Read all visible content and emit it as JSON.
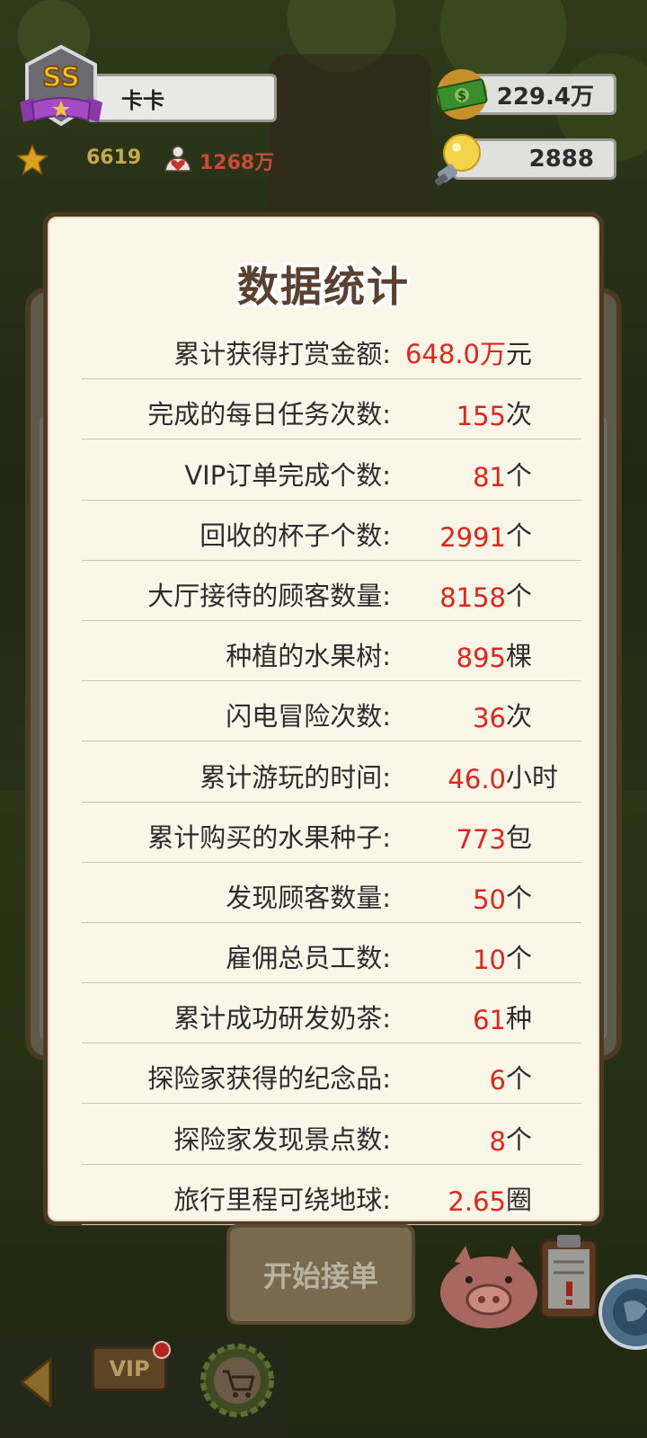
{
  "player": {
    "rank": "SS",
    "name": "卡卡",
    "stars": "6619",
    "fans": "1268万"
  },
  "currency": {
    "money": "229.4万",
    "ideas": "2888"
  },
  "modal": {
    "title": "数据统计",
    "stats": [
      {
        "label": "累计获得打赏金额:",
        "value": "648.0万",
        "unit": "元"
      },
      {
        "label": "完成的每日任务次数:",
        "value": "155",
        "unit": "次"
      },
      {
        "label": "VIP订单完成个数:",
        "value": "81",
        "unit": "个"
      },
      {
        "label": "回收的杯子个数:",
        "value": "2991",
        "unit": "个"
      },
      {
        "label": "大厅接待的顾客数量:",
        "value": "8158",
        "unit": "个"
      },
      {
        "label": "种植的水果树:",
        "value": "895",
        "unit": "棵"
      },
      {
        "label": "闪电冒险次数:",
        "value": "36",
        "unit": "次"
      },
      {
        "label": "累计游玩的时间:",
        "value": "46.0",
        "unit": "小时"
      },
      {
        "label": "累计购买的水果种子:",
        "value": "773",
        "unit": "包"
      },
      {
        "label": "发现顾客数量:",
        "value": "50",
        "unit": "个"
      },
      {
        "label": "雇佣总员工数:",
        "value": "10",
        "unit": "个"
      },
      {
        "label": "累计成功研发奶茶:",
        "value": "61",
        "unit": "种"
      },
      {
        "label": "探险家获得的纪念品:",
        "value": "6",
        "unit": "个"
      },
      {
        "label": "探险家发现景点数:",
        "value": "8",
        "unit": "个"
      },
      {
        "label": "旅行里程可绕地球:",
        "value": "2.65",
        "unit": "圈"
      }
    ]
  },
  "bottom": {
    "start_button": "开始接单",
    "vip_label": "VIP"
  },
  "colors": {
    "value_red": "#e3241b",
    "panel_bg": "#fbf7e8",
    "panel_border": "#4d3a24",
    "title_brown": "#5a4030"
  },
  "icons": [
    "rank-badge-icon",
    "star-icon",
    "heart-fan-icon",
    "money-bill-icon",
    "lightbulb-icon",
    "pig-bank-icon",
    "clipboard-icon",
    "globe-icon",
    "back-arrow-icon",
    "vip-icon",
    "shop-cart-icon"
  ]
}
